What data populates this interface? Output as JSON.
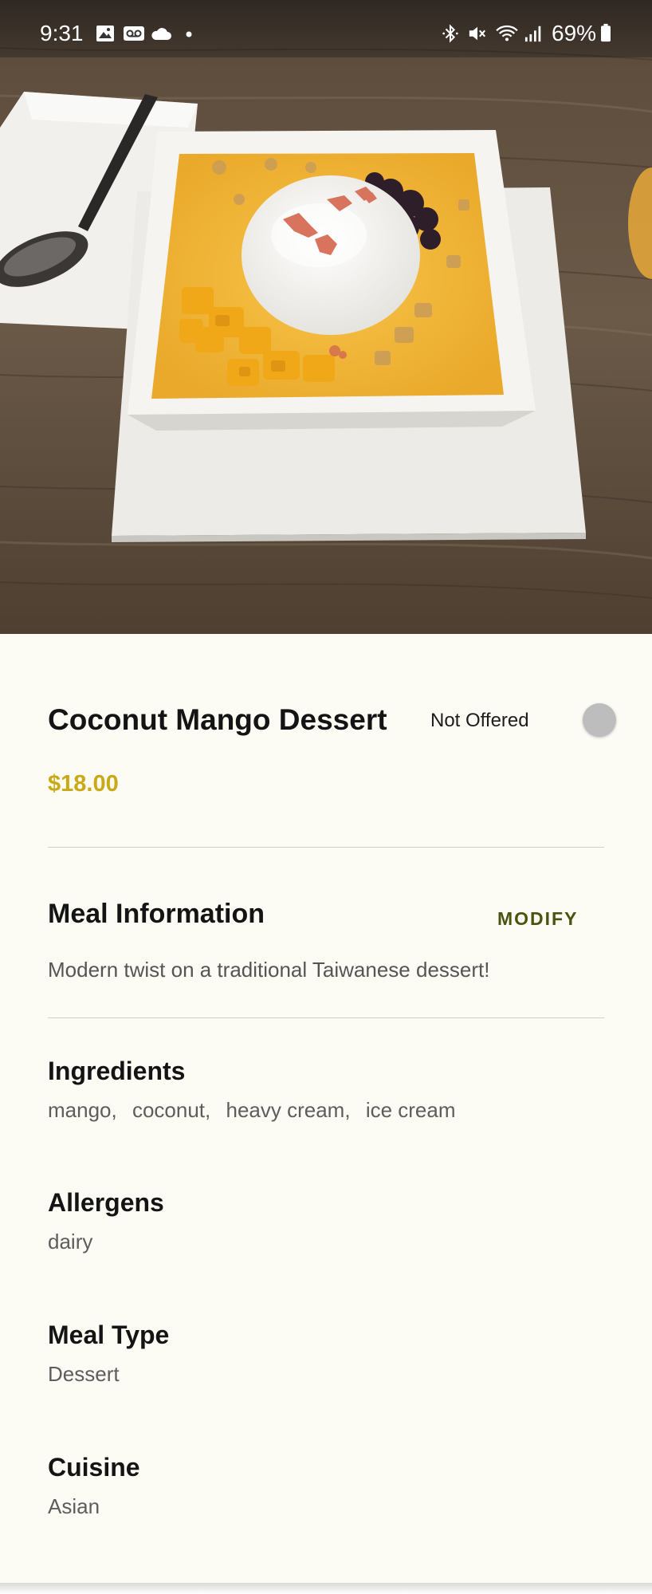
{
  "status_bar": {
    "time": "9:31",
    "battery": "69%",
    "left_icons": [
      "gallery-icon",
      "voicemail-icon",
      "cloud-icon",
      "dot-icon"
    ],
    "right_icons": [
      "bluetooth-icon",
      "mute-icon",
      "wifi-icon",
      "signal-icon",
      "battery-icon"
    ]
  },
  "meal": {
    "title": "Coconut Mango Dessert",
    "price": "$18.00",
    "offer_label": "Not Offered",
    "offered": false
  },
  "meal_information": {
    "heading": "Meal Information",
    "modify_label": "MODIFY",
    "description": "Modern twist on a traditional Taiwanese dessert!"
  },
  "ingredients": {
    "heading": "Ingredients",
    "items": [
      "mango,",
      "coconut,",
      "heavy cream,",
      "ice cream"
    ]
  },
  "allergens": {
    "heading": "Allergens",
    "value": "dairy"
  },
  "meal_type": {
    "heading": "Meal Type",
    "value": "Dessert"
  },
  "cuisine": {
    "heading": "Cuisine",
    "value": "Asian"
  },
  "colors": {
    "price": "#c9a915",
    "modify": "#4a5410",
    "background": "#fcfbf4",
    "toggle_off": "#bdbdbd"
  }
}
